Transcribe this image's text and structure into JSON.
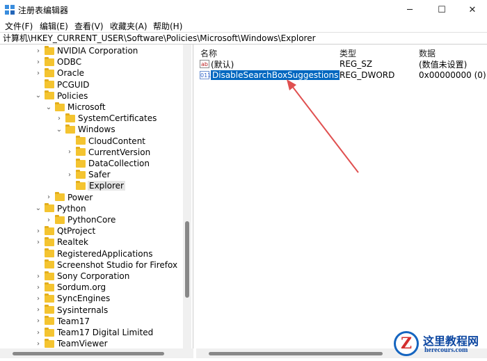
{
  "window": {
    "title": "注册表编辑器",
    "controls": {
      "minimize": "─",
      "maximize": "☐",
      "close": "✕"
    }
  },
  "menu": [
    "文件(F)",
    "编辑(E)",
    "查看(V)",
    "收藏夹(A)",
    "帮助(H)"
  ],
  "address": "计算机\\HKEY_CURRENT_USER\\Software\\Policies\\Microsoft\\Windows\\Explorer",
  "tree": [
    {
      "label": "NVIDIA Corporation",
      "chevron": "›",
      "level": 0
    },
    {
      "label": "ODBC",
      "chevron": "›",
      "level": 0
    },
    {
      "label": "Oracle",
      "chevron": "›",
      "level": 0
    },
    {
      "label": "PCGUID",
      "chevron": "",
      "level": 0
    },
    {
      "label": "Policies",
      "chevron": "⌄",
      "level": 0
    },
    {
      "label": "Microsoft",
      "chevron": "⌄",
      "level": 1
    },
    {
      "label": "SystemCertificates",
      "chevron": "›",
      "level": 2
    },
    {
      "label": "Windows",
      "chevron": "⌄",
      "level": 2
    },
    {
      "label": "CloudContent",
      "chevron": "",
      "level": 3
    },
    {
      "label": "CurrentVersion",
      "chevron": "›",
      "level": 3
    },
    {
      "label": "DataCollection",
      "chevron": "",
      "level": 3
    },
    {
      "label": "Safer",
      "chevron": "›",
      "level": 3
    },
    {
      "label": "Explorer",
      "chevron": "",
      "level": 3,
      "selected": true
    },
    {
      "label": "Power",
      "chevron": "›",
      "level": 1
    },
    {
      "label": "Python",
      "chevron": "⌄",
      "level": 0
    },
    {
      "label": "PythonCore",
      "chevron": "›",
      "level": 1
    },
    {
      "label": "QtProject",
      "chevron": "›",
      "level": 0
    },
    {
      "label": "Realtek",
      "chevron": "›",
      "level": 0
    },
    {
      "label": "RegisteredApplications",
      "chevron": "",
      "level": 0
    },
    {
      "label": "Screenshot Studio for Firefox",
      "chevron": "",
      "level": 0
    },
    {
      "label": "Sony Corporation",
      "chevron": "›",
      "level": 0
    },
    {
      "label": "Sordum.org",
      "chevron": "›",
      "level": 0
    },
    {
      "label": "SyncEngines",
      "chevron": "›",
      "level": 0
    },
    {
      "label": "Sysinternals",
      "chevron": "›",
      "level": 0
    },
    {
      "label": "Team17",
      "chevron": "›",
      "level": 0
    },
    {
      "label": "Team17 Digital Limited",
      "chevron": "›",
      "level": 0
    },
    {
      "label": "TeamViewer",
      "chevron": "›",
      "level": 0
    }
  ],
  "list": {
    "headers": {
      "name": "名称",
      "type": "类型",
      "data": "数据"
    },
    "rows": [
      {
        "icon": "ab",
        "name": "(默认)",
        "type": "REG_SZ",
        "data": "(数值未设置)"
      },
      {
        "icon": "011",
        "name": "DisableSearchBoxSuggestions",
        "type": "REG_DWORD",
        "data": "0x00000000 (0)",
        "selected": true
      }
    ]
  },
  "watermark": {
    "logo": "Z",
    "title": "这里教程网",
    "url": "herecours.com"
  },
  "colors": {
    "selection": "#0067c0",
    "folder": "#f4c430",
    "arrow": "#e05050"
  }
}
